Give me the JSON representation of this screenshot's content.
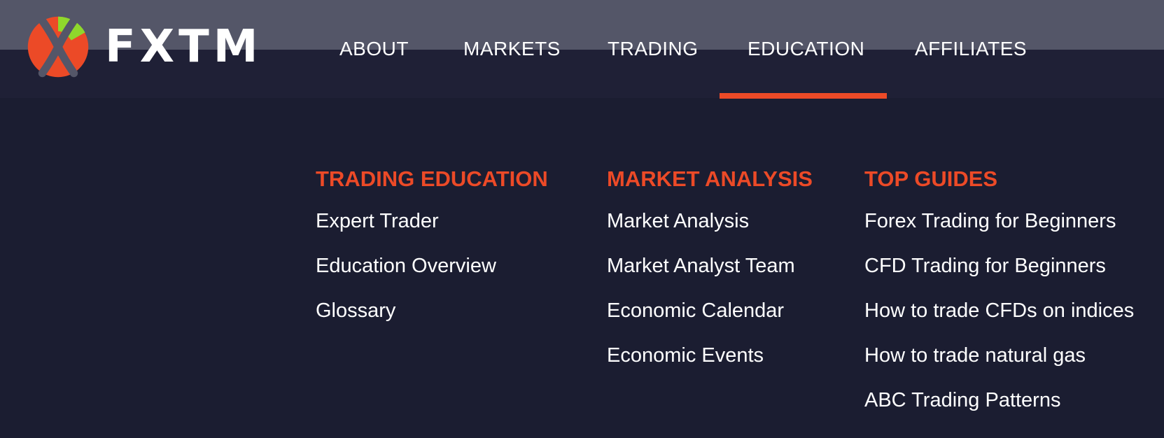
{
  "brand": {
    "name": "FXTM",
    "colors": {
      "accent": "#ec4a27",
      "logo_green": "#8fd82c",
      "logo_grey": "#545668",
      "background": "#1b1d31"
    }
  },
  "nav": {
    "items": [
      {
        "label": "ABOUT"
      },
      {
        "label": "MARKETS"
      },
      {
        "label": "TRADING"
      },
      {
        "label": "EDUCATION",
        "active": true
      },
      {
        "label": "AFFILIATES"
      }
    ]
  },
  "menu": {
    "columns": [
      {
        "heading": "TRADING EDUCATION",
        "links": [
          "Expert Trader",
          "Education Overview",
          "Glossary"
        ]
      },
      {
        "heading": "MARKET ANALYSIS",
        "links": [
          "Market Analysis",
          "Market Analyst Team",
          "Economic Calendar",
          "Economic Events"
        ]
      },
      {
        "heading": "TOP GUIDES",
        "links": [
          "Forex Trading for Beginners",
          "CFD Trading for Beginners",
          "How to trade CFDs on indices",
          "How to trade natural gas",
          "ABC Trading Patterns"
        ]
      }
    ]
  }
}
